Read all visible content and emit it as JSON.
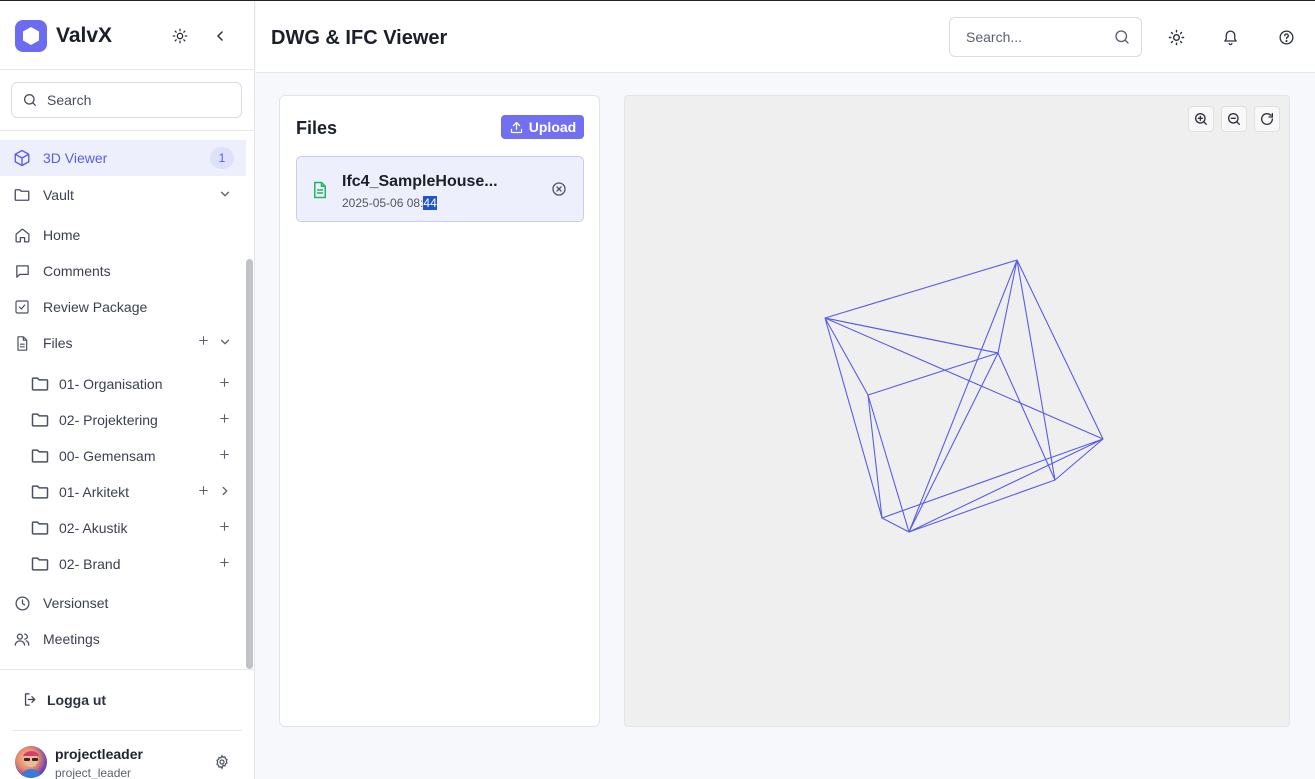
{
  "app": {
    "name": "ValvX"
  },
  "sidebar": {
    "search_label": "Search",
    "nav": [
      {
        "label": "3D Viewer",
        "badge": "1",
        "icon": "cube-icon"
      },
      {
        "label": "Vault",
        "icon": "folder-icon"
      },
      {
        "label": "Home",
        "icon": "home-icon"
      },
      {
        "label": "Comments",
        "icon": "comment-icon"
      },
      {
        "label": "Review Package",
        "icon": "checkbox-icon"
      },
      {
        "label": "Files",
        "icon": "file-icon"
      }
    ],
    "folders": [
      {
        "label": "01- Organisation"
      },
      {
        "label": "02- Projektering"
      },
      {
        "label": "00- Gemensam"
      },
      {
        "label": "01- Arkitekt"
      },
      {
        "label": "02- Akustik"
      },
      {
        "label": "02- Brand"
      }
    ],
    "nav_bottom": [
      {
        "label": "Versionset",
        "icon": "clock-icon"
      },
      {
        "label": "Meetings",
        "icon": "users-icon"
      }
    ],
    "logout_label": "Logga ut",
    "user": {
      "name": "projectleader",
      "role": "project_leader"
    }
  },
  "header": {
    "title": "DWG & IFC Viewer",
    "search_placeholder": "Search..."
  },
  "files_panel": {
    "title": "Files",
    "upload_label": "Upload",
    "files": [
      {
        "name": "Ifc4_SampleHouse...",
        "date_prefix": "2025-05-06 08:",
        "date_selected": "44"
      }
    ]
  },
  "colors": {
    "accent": "#6c6cf0",
    "model_line": "#5b5ce6",
    "file_icon": "#22b363"
  }
}
